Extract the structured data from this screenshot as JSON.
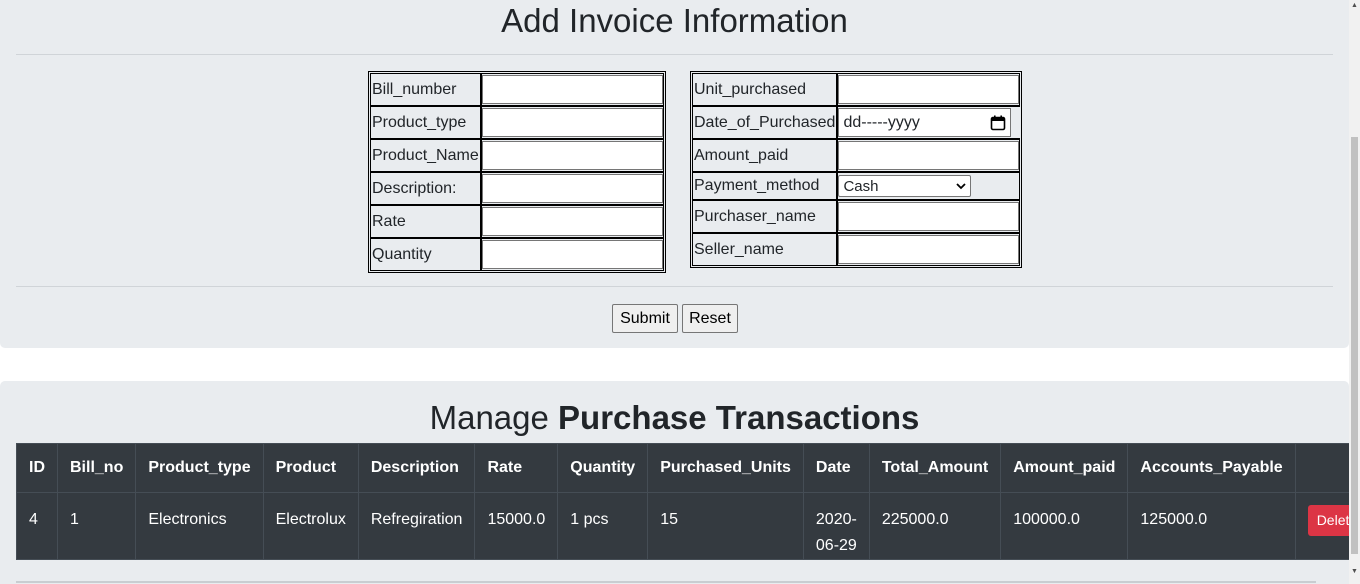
{
  "form": {
    "title": "Add Invoice Information",
    "left_fields": [
      {
        "label": "Bill_number",
        "value": ""
      },
      {
        "label": "Product_type",
        "value": ""
      },
      {
        "label": "Product_Name",
        "value": ""
      },
      {
        "label": "Description:",
        "value": ""
      },
      {
        "label": "Rate",
        "value": ""
      },
      {
        "label": "Quantity",
        "value": ""
      }
    ],
    "right_fields": {
      "unit_purchased": {
        "label": "Unit_purchased",
        "value": ""
      },
      "date": {
        "label": "Date_of_Purchased",
        "placeholder": "dd-----yyyy"
      },
      "amount_paid": {
        "label": "Amount_paid",
        "value": ""
      },
      "payment_method": {
        "label": "Payment_method",
        "selected": "Cash"
      },
      "purchaser_name": {
        "label": "Purchaser_name",
        "value": ""
      },
      "seller_name": {
        "label": "Seller_name",
        "value": ""
      }
    },
    "submit_label": "Submit",
    "reset_label": "Reset"
  },
  "manage": {
    "title_normal": "Manage ",
    "title_bold": "Purchase Transactions",
    "columns": [
      "ID",
      "Bill_no",
      "Product_type",
      "Product",
      "Description",
      "Rate",
      "Quantity",
      "Purchased_Units",
      "Date",
      "Total_Amount",
      "Amount_paid",
      "Accounts_Payable",
      ""
    ],
    "rows": [
      {
        "id": "4",
        "bill_no": "1",
        "product_type": "Electronics",
        "product": "Electrolux",
        "description": "Refregiration",
        "rate": "15000.0",
        "quantity": "1 pcs",
        "purchased_units": "15",
        "date": "2020-06-29",
        "total_amount": "225000.0",
        "amount_paid": "100000.0",
        "accounts_payable": "125000.0",
        "action_label": "Delete"
      }
    ]
  },
  "colors": {
    "panel_bg": "#e9ecef",
    "table_bg": "#343a40",
    "delete_btn": "#dc3545"
  },
  "icons": {
    "calendar": "calendar-icon",
    "select_arrow": "chevron-down-icon"
  }
}
